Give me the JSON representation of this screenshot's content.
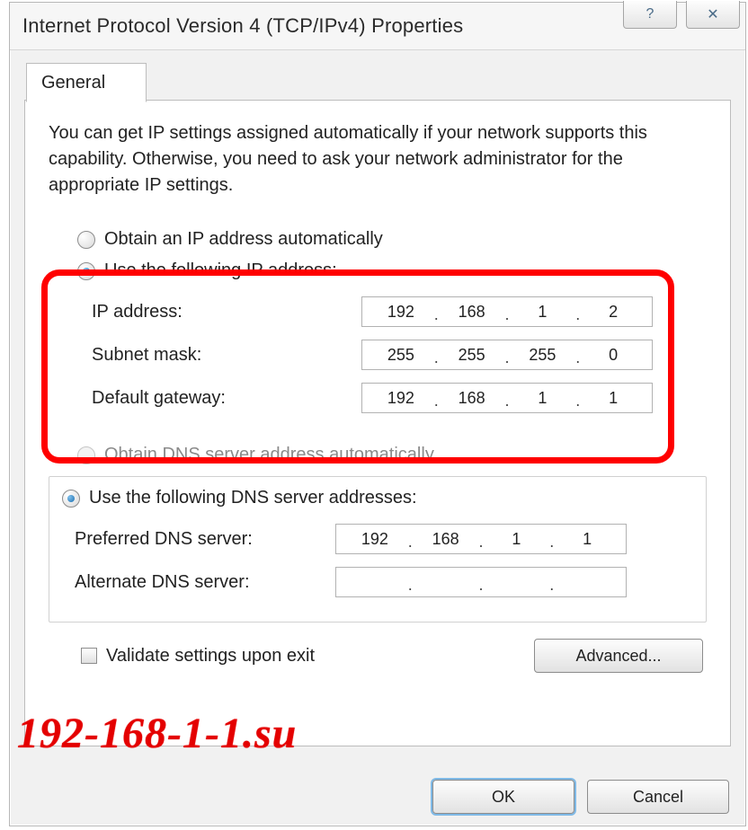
{
  "window": {
    "title": "Internet Protocol Version 4 (TCP/IPv4) Properties",
    "help_glyph": "?",
    "close_glyph": "✕"
  },
  "tab": {
    "label": "General"
  },
  "intro": "You can get IP settings assigned automatically if your network supports this capability. Otherwise, you need to ask your network administrator for the appropriate IP settings.",
  "ip": {
    "auto_label": "Obtain an IP address automatically",
    "manual_label": "Use the following IP address:",
    "addr_label": "IP address:",
    "mask_label": "Subnet mask:",
    "gw_label": "Default gateway:",
    "addr": [
      "192",
      "168",
      "1",
      "2"
    ],
    "mask": [
      "255",
      "255",
      "255",
      "0"
    ],
    "gw": [
      "192",
      "168",
      "1",
      "1"
    ]
  },
  "dns": {
    "auto_label": "Obtain DNS server address automatically",
    "manual_label": "Use the following DNS server addresses:",
    "pref_label": "Preferred DNS server:",
    "alt_label": "Alternate DNS server:",
    "pref": [
      "192",
      "168",
      "1",
      "1"
    ],
    "alt": [
      "",
      "",
      "",
      ""
    ]
  },
  "validate_label": "Validate settings upon exit",
  "advanced_label": "Advanced...",
  "ok_label": "OK",
  "cancel_label": "Cancel",
  "watermark": "192-168-1-1.su",
  "dot": "."
}
